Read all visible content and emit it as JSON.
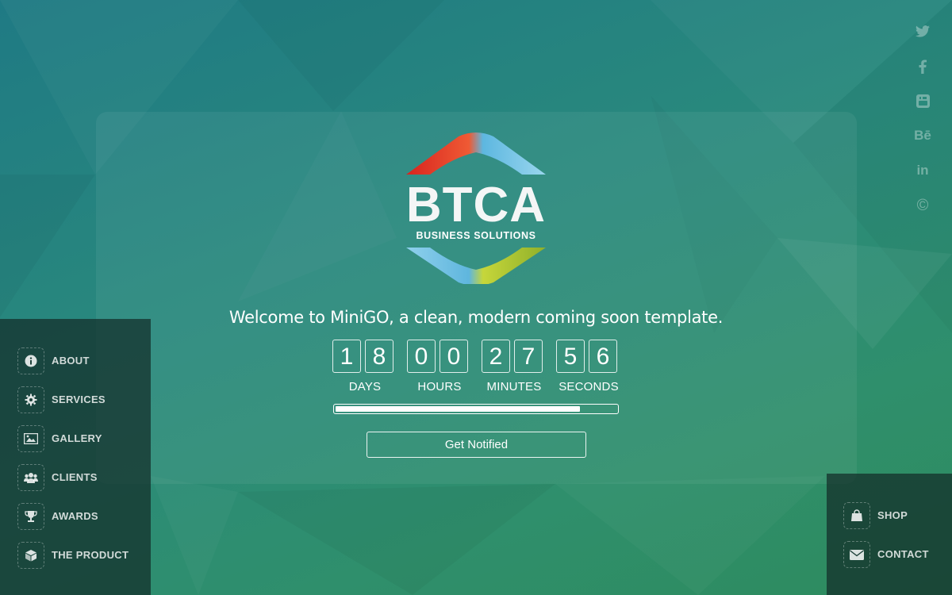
{
  "brand": {
    "name": "BTCA",
    "tagline": "BUSINESS SOLUTIONS"
  },
  "welcome_text": "Welcome to MiniGO, a clean, modern coming soon template.",
  "countdown": {
    "days": {
      "d1": "1",
      "d2": "8",
      "label": "DAYS"
    },
    "hours": {
      "d1": "0",
      "d2": "0",
      "label": "HOURS"
    },
    "minutes": {
      "d1": "2",
      "d2": "7",
      "label": "MINUTES"
    },
    "seconds": {
      "d1": "5",
      "d2": "6",
      "label": "SECONDS"
    }
  },
  "progress_fraction": 0.87,
  "notify_button": "Get Notified",
  "social": [
    {
      "name": "twitter-icon"
    },
    {
      "name": "facebook-icon"
    },
    {
      "name": "youtube-icon"
    },
    {
      "name": "behance-icon",
      "glyph": "Bē"
    },
    {
      "name": "linkedin-icon",
      "glyph": "in"
    },
    {
      "name": "copyright-icon",
      "glyph": "©"
    }
  ],
  "left_nav": [
    {
      "label": "ABOUT",
      "icon": "info-icon"
    },
    {
      "label": "SERVICES",
      "icon": "gear-icon"
    },
    {
      "label": "GALLERY",
      "icon": "image-icon"
    },
    {
      "label": "CLIENTS",
      "icon": "users-icon"
    },
    {
      "label": "AWARDS",
      "icon": "trophy-icon"
    },
    {
      "label": "THE PRODUCT",
      "icon": "cube-icon"
    }
  ],
  "right_nav": [
    {
      "label": "SHOP",
      "icon": "shopping-bag-icon"
    },
    {
      "label": "CONTACT",
      "icon": "envelope-icon"
    }
  ],
  "colors": {
    "bg_top": "#1f7a84",
    "bg_bottom": "#2e8b5e",
    "nav_bg": "#173a33",
    "logo_red": "#e2332a",
    "logo_blue": "#6cc3e2",
    "logo_green": "#a8c42c"
  }
}
